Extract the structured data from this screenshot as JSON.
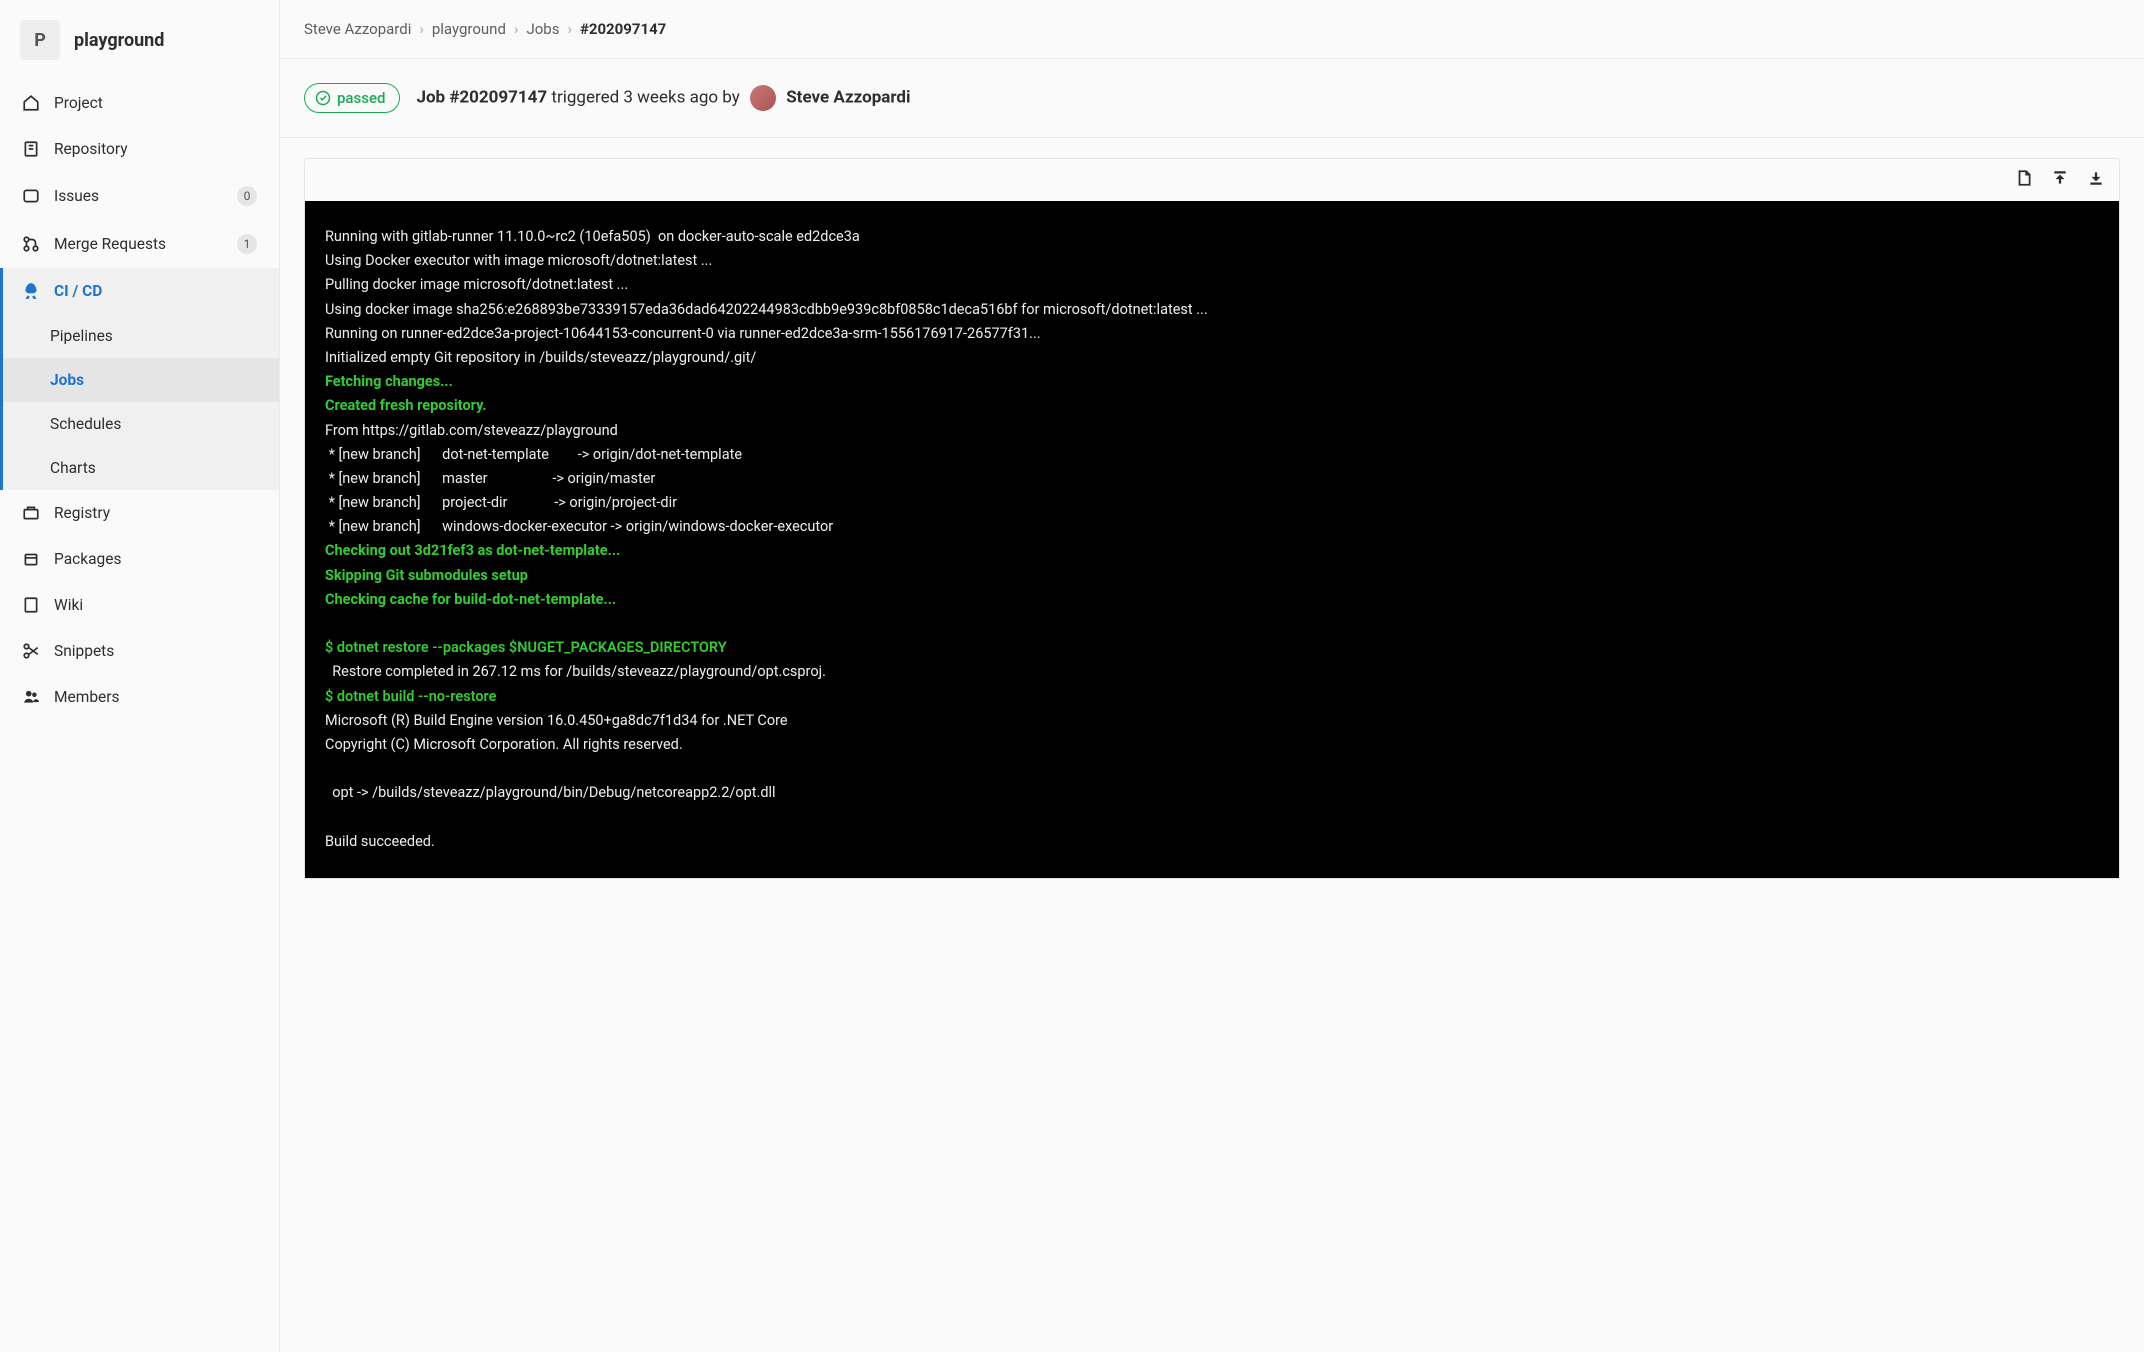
{
  "project": {
    "avatar": "P",
    "name": "playground"
  },
  "sidebar": {
    "items": [
      {
        "label": "Project"
      },
      {
        "label": "Repository"
      },
      {
        "label": "Issues",
        "badge": "0"
      },
      {
        "label": "Merge Requests",
        "badge": "1"
      },
      {
        "label": "CI / CD"
      },
      {
        "label": "Registry"
      },
      {
        "label": "Packages"
      },
      {
        "label": "Wiki"
      },
      {
        "label": "Snippets"
      },
      {
        "label": "Members"
      }
    ],
    "cicd_sub": [
      {
        "label": "Pipelines"
      },
      {
        "label": "Jobs"
      },
      {
        "label": "Schedules"
      },
      {
        "label": "Charts"
      }
    ]
  },
  "breadcrumb": {
    "owner": "Steve Azzopardi",
    "project": "playground",
    "section": "Jobs",
    "id": "#202097147"
  },
  "status": {
    "label": "passed"
  },
  "job": {
    "title_prefix": "Job #202097147",
    "triggered": "triggered 3 weeks ago by",
    "author": "Steve Azzopardi"
  },
  "log": {
    "l0": "Running with gitlab-runner 11.10.0~rc2 (10efa505)  on docker-auto-scale ed2dce3a",
    "l1": "Using Docker executor with image microsoft/dotnet:latest ...",
    "l2": "Pulling docker image microsoft/dotnet:latest ...",
    "l3": "Using docker image sha256:e268893be73339157eda36dad64202244983cdbb9e939c8bf0858c1deca516bf for microsoft/dotnet:latest ...",
    "l4": "Running on runner-ed2dce3a-project-10644153-concurrent-0 via runner-ed2dce3a-srm-1556176917-26577f31...",
    "l5": "Initialized empty Git repository in /builds/steveazz/playground/.git/",
    "l6": "Fetching changes...",
    "l7": "Created fresh repository.",
    "l8": "From https://gitlab.com/steveazz/playground",
    "l9": " * [new branch]      dot-net-template        -> origin/dot-net-template",
    "l10": " * [new branch]      master                  -> origin/master",
    "l11": " * [new branch]      project-dir             -> origin/project-dir",
    "l12": " * [new branch]      windows-docker-executor -> origin/windows-docker-executor",
    "l13": "Checking out 3d21fef3 as dot-net-template...",
    "l14": "Skipping Git submodules setup",
    "l15": "Checking cache for build-dot-net-template...",
    "l16": "",
    "l17": "$ dotnet restore --packages $NUGET_PACKAGES_DIRECTORY",
    "l18": "  Restore completed in 267.12 ms for /builds/steveazz/playground/opt.csproj.",
    "l19": "$ dotnet build --no-restore",
    "l20": "Microsoft (R) Build Engine version 16.0.450+ga8dc7f1d34 for .NET Core",
    "l21": "Copyright (C) Microsoft Corporation. All rights reserved.",
    "l22": "",
    "l23": "  opt -> /builds/steveazz/playground/bin/Debug/netcoreapp2.2/opt.dll",
    "l24": "",
    "l25": "Build succeeded."
  }
}
